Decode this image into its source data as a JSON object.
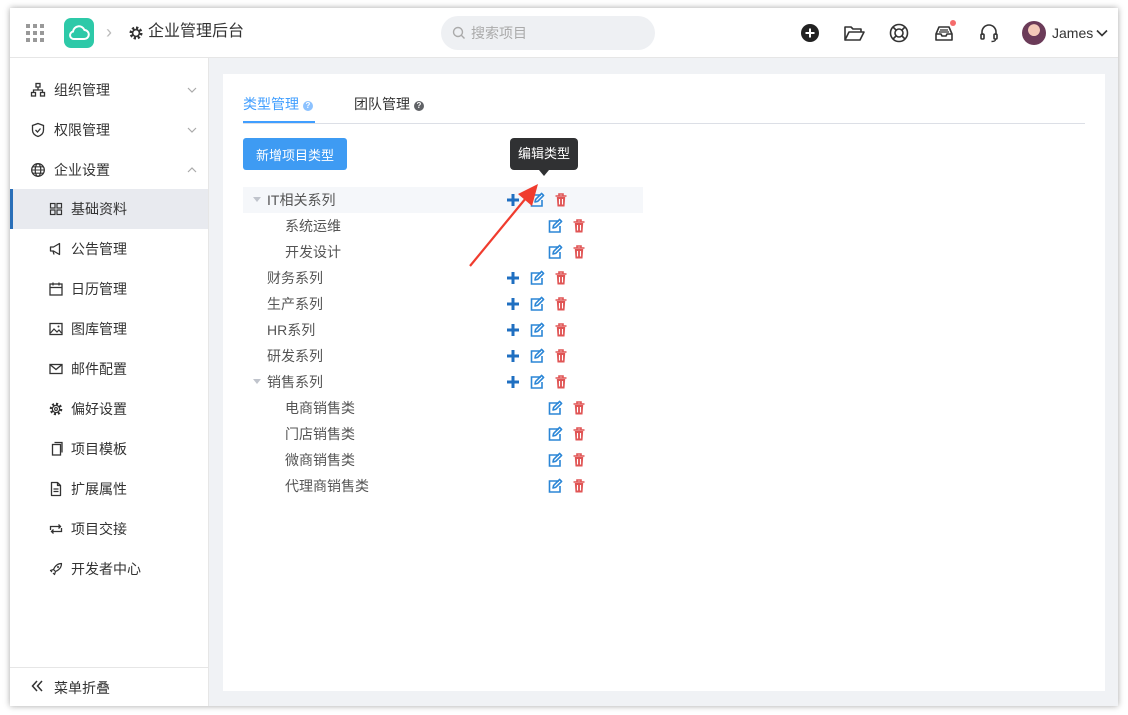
{
  "header": {
    "app_title": "企业管理后台",
    "search_placeholder": "搜索项目",
    "user_name": "James",
    "icons": [
      "apps-grid-icon",
      "cloud-logo-icon",
      "gear-icon",
      "search-icon",
      "plus-circle-icon",
      "folder-open-icon",
      "lifebuoy-icon",
      "inbox-icon",
      "headset-icon",
      "avatar",
      "chevron-down-icon"
    ]
  },
  "sidebar": {
    "groups": [
      {
        "label": "组织管理",
        "icon": "org-chart-icon",
        "expanded": false
      },
      {
        "label": "权限管理",
        "icon": "shield-icon",
        "expanded": false
      },
      {
        "label": "企业设置",
        "icon": "globe-icon",
        "expanded": true
      }
    ],
    "items": [
      {
        "label": "基础资料",
        "icon": "grid-icon",
        "active": true
      },
      {
        "label": "公告管理",
        "icon": "megaphone-icon"
      },
      {
        "label": "日历管理",
        "icon": "calendar-icon"
      },
      {
        "label": "图库管理",
        "icon": "image-icon"
      },
      {
        "label": "邮件配置",
        "icon": "mail-icon"
      },
      {
        "label": "偏好设置",
        "icon": "settings-icon"
      },
      {
        "label": "项目模板",
        "icon": "copy-icon"
      },
      {
        "label": "扩展属性",
        "icon": "document-icon"
      },
      {
        "label": "项目交接",
        "icon": "swap-icon"
      },
      {
        "label": "开发者中心",
        "icon": "rocket-icon"
      }
    ],
    "collapse_label": "菜单折叠"
  },
  "tabs": [
    {
      "label": "类型管理",
      "active": true
    },
    {
      "label": "团队管理",
      "active": false
    }
  ],
  "add_button_label": "新增项目类型",
  "tooltip": "编辑类型",
  "tree": [
    {
      "label": "IT相关系列",
      "level": 0,
      "expanded": true,
      "hover": true
    },
    {
      "label": "系统运维",
      "level": 1
    },
    {
      "label": "开发设计",
      "level": 1
    },
    {
      "label": "财务系列",
      "level": 0
    },
    {
      "label": "生产系列",
      "level": 0
    },
    {
      "label": "HR系列",
      "level": 0
    },
    {
      "label": "研发系列",
      "level": 0
    },
    {
      "label": "销售系列",
      "level": 0,
      "expanded": true
    },
    {
      "label": "电商销售类",
      "level": 1
    },
    {
      "label": "门店销售类",
      "level": 1
    },
    {
      "label": "微商销售类",
      "level": 1
    },
    {
      "label": "代理商销售类",
      "level": 1
    }
  ],
  "colors": {
    "primary": "#409eff",
    "button": "#3e9bf3",
    "add_icon": "#1f6fc1",
    "edit_icon": "#2b86d6",
    "delete_icon": "#e05555",
    "annotation_arrow": "#f03c2e",
    "logo": "#2dc9a8"
  }
}
